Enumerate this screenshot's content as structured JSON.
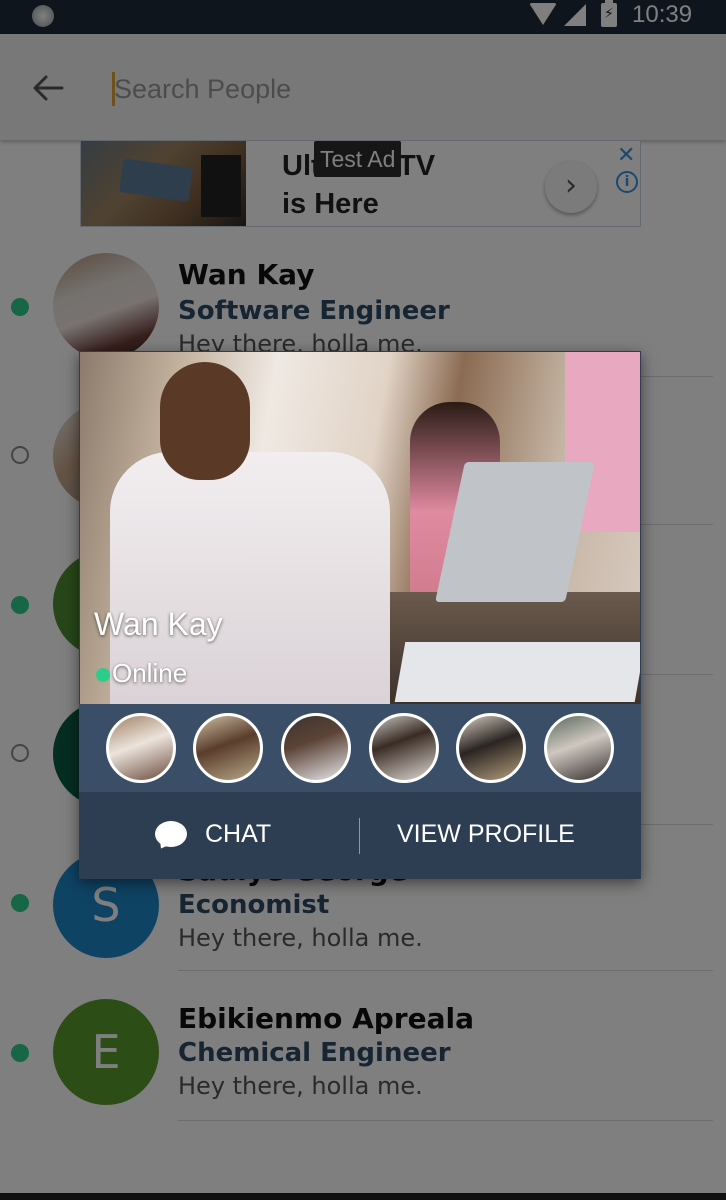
{
  "status_bar": {
    "time": "10:39",
    "battery_glyph": "⚡"
  },
  "search": {
    "placeholder": "Search People",
    "value": ""
  },
  "ad": {
    "badge": "Test Ad",
    "title_line1": "Ultra HDTV",
    "title_line2": "is Here",
    "arrow_glyph": "›",
    "close_glyph": "✕",
    "info_glyph": "i"
  },
  "contacts": [
    {
      "name": "Wan Kay",
      "role": "Software Engineer",
      "status_text": "Hey there, holla me.",
      "online": true,
      "initial": ""
    },
    {
      "name": "",
      "role": "",
      "status_text": "",
      "online": false,
      "initial": ""
    },
    {
      "name": "",
      "role": "",
      "status_text": "",
      "online": true,
      "initial": ""
    },
    {
      "name": "",
      "role": "",
      "status_text": "",
      "online": false,
      "initial": ""
    },
    {
      "name": "Sadiye George",
      "role": "Economist",
      "status_text": "Hey there, holla me.",
      "online": true,
      "initial": "S"
    },
    {
      "name": "Ebikienmo Apreala",
      "role": "Chemical Engineer",
      "status_text": "Hey there, holla me.",
      "online": true,
      "initial": "E"
    }
  ],
  "popup": {
    "name": "Wan Kay",
    "status": "Online",
    "chat_label": "CHAT",
    "view_profile_label": "VIEW PROFILE",
    "photo_count": 6
  },
  "colors": {
    "accent_green": "#2ecc8a",
    "role_text": "#2c4a62",
    "popup_bg": "#2e3e52",
    "avatar_s": "#1e86c8",
    "avatar_e": "#5a9a2e"
  }
}
